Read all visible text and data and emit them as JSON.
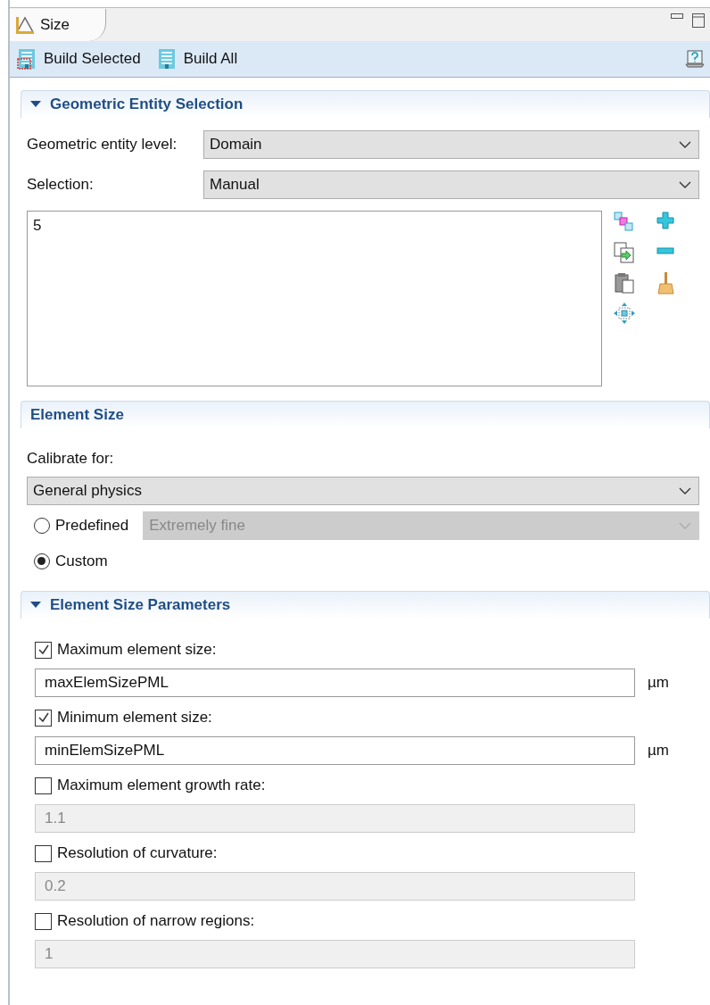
{
  "tab": {
    "title": "Size",
    "selected": true
  },
  "toolbar": {
    "buttons": [
      {
        "label": "Build Selected",
        "kind": "selected"
      },
      {
        "label": "Build All",
        "kind": "all"
      }
    ]
  },
  "sections": [
    {
      "title": "Geometric Entity Selection",
      "collapsible": true,
      "kind": "selection",
      "rows": [
        {
          "label": "Geometric entity level:",
          "value": "Domain"
        },
        {
          "label": "Selection:",
          "value": "Manual"
        }
      ],
      "list_items": [
        "5"
      ]
    },
    {
      "title": "Element Size",
      "collapsible": false,
      "kind": "size",
      "calibrate_label": "Calibrate for:",
      "calibrate_value": "General physics",
      "options": [
        {
          "label": "Predefined",
          "selected": false,
          "dropdown": "Extremely fine"
        },
        {
          "label": "Custom",
          "selected": true
        }
      ]
    },
    {
      "title": "Element Size Parameters",
      "collapsible": true,
      "kind": "params",
      "params": [
        {
          "label": "Maximum element size:",
          "checked": true,
          "value": "maxElemSizePML",
          "unit": "µm"
        },
        {
          "label": "Minimum element size:",
          "checked": true,
          "value": "minElemSizePML",
          "unit": "µm"
        },
        {
          "label": "Maximum element growth rate:",
          "checked": false,
          "value": "1.1"
        },
        {
          "label": "Resolution of curvature:",
          "checked": false,
          "value": "0.2"
        },
        {
          "label": "Resolution of narrow regions:",
          "checked": false,
          "value": "1"
        }
      ]
    }
  ]
}
